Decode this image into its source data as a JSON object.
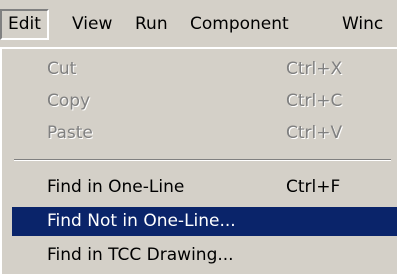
{
  "menubar": {
    "items": [
      {
        "label": "Edit"
      },
      {
        "label": "View"
      },
      {
        "label": "Run"
      },
      {
        "label": "Component"
      },
      {
        "label": "Winc"
      }
    ]
  },
  "edit_menu": {
    "items": [
      {
        "label": "Cut",
        "shortcut": "Ctrl+X",
        "state": "disabled"
      },
      {
        "label": "Copy",
        "shortcut": "Ctrl+C",
        "state": "disabled"
      },
      {
        "label": "Paste",
        "shortcut": "Ctrl+V",
        "state": "disabled"
      },
      {
        "label": "Find in One-Line",
        "shortcut": "Ctrl+F",
        "state": "enabled"
      },
      {
        "label": "Find Not in One-Line...",
        "shortcut": "",
        "state": "highlighted"
      },
      {
        "label": "Find in TCC Drawing...",
        "shortcut": "",
        "state": "enabled"
      }
    ]
  },
  "colors": {
    "face": "#d4d0c8",
    "highlight": "#0a246a",
    "disabled_text": "#808080"
  }
}
